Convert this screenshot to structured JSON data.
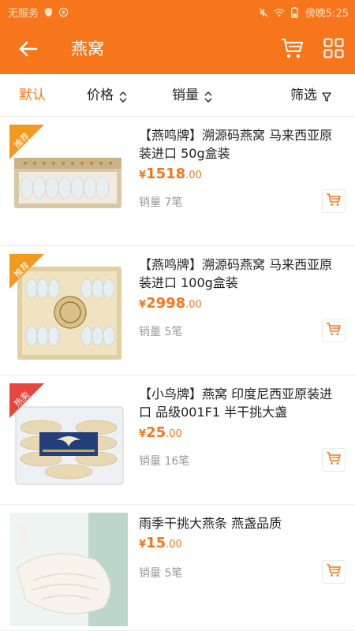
{
  "status_bar": {
    "carrier": "无服务",
    "time": "傍晚5:25"
  },
  "header": {
    "title": "燕窝",
    "back_icon": "arrow-left-icon",
    "cart_icon": "cart-icon",
    "grid_icon": "grid-icon"
  },
  "sort_bar": {
    "default_label": "默认",
    "price_label": "价格",
    "sales_label": "销量",
    "filter_label": "筛选"
  },
  "colors": {
    "accent": "#f7761b",
    "tag_recommend": "#f39a1e",
    "tag_hot": "#e8453c"
  },
  "products": [
    {
      "tag": "推荐",
      "title": "【燕鸣牌】溯源码燕窝 马来西亚原装进口 50g盒装",
      "price_symbol": "¥",
      "price_int": "1518",
      "price_dec": ".00",
      "sales": "销量 7笔"
    },
    {
      "tag": "推荐",
      "title": "【燕鸣牌】溯源码燕窝 马来西亚原装进口 100g盒装",
      "price_symbol": "¥",
      "price_int": "2998",
      "price_dec": ".00",
      "sales": "销量 5笔"
    },
    {
      "tag": "热卖",
      "title": "【小鸟牌】燕窝 印度尼西亚原装进口 品级001F1 半干挑大盏",
      "price_symbol": "¥",
      "price_int": "25",
      "price_dec": ".00",
      "sales": "销量 16笔"
    },
    {
      "tag": "",
      "title": "雨季干挑大燕条 燕盏品质",
      "price_symbol": "¥",
      "price_int": "15",
      "price_dec": ".00",
      "sales": "销量 5笔"
    }
  ]
}
